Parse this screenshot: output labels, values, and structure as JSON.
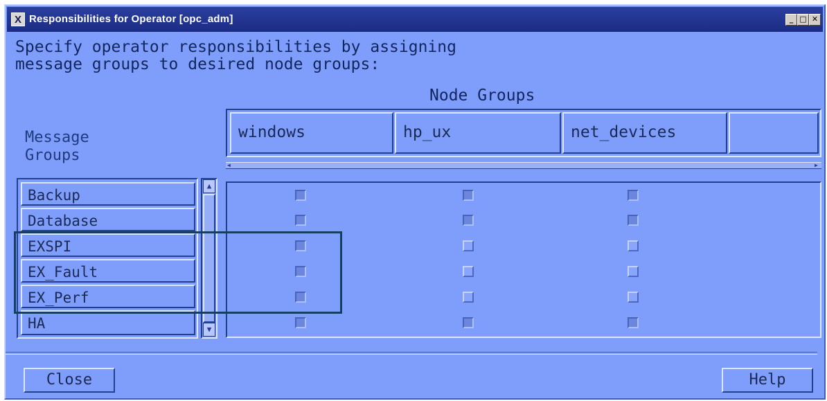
{
  "window": {
    "title": "Responsibilities for Operator  [opc_adm]",
    "icon_glyph": "X",
    "minimize_glyph": "_",
    "maximize_glyph": "□",
    "close_glyph": "✕"
  },
  "instructions": "Specify operator responsibilities by assigning\nmessage groups to desired node groups:",
  "node_groups_label": "Node Groups",
  "message_groups_label": "Message\nGroups",
  "node_groups": [
    "windows",
    "hp_ux",
    "net_devices"
  ],
  "message_groups": [
    "Backup",
    "Database",
    "EXSPI",
    "EX_Fault",
    "EX_Perf",
    "HA"
  ],
  "matrix": [
    [
      true,
      true,
      true
    ],
    [
      true,
      true,
      true
    ],
    [
      true,
      false,
      false
    ],
    [
      true,
      false,
      false
    ],
    [
      true,
      false,
      false
    ],
    [
      true,
      true,
      true
    ]
  ],
  "buttons": {
    "close": "Close",
    "help": "Help"
  },
  "colors": {
    "background": "#7f9efb",
    "titlebar": "#1c2c85",
    "highlight_border": "#143e63"
  }
}
